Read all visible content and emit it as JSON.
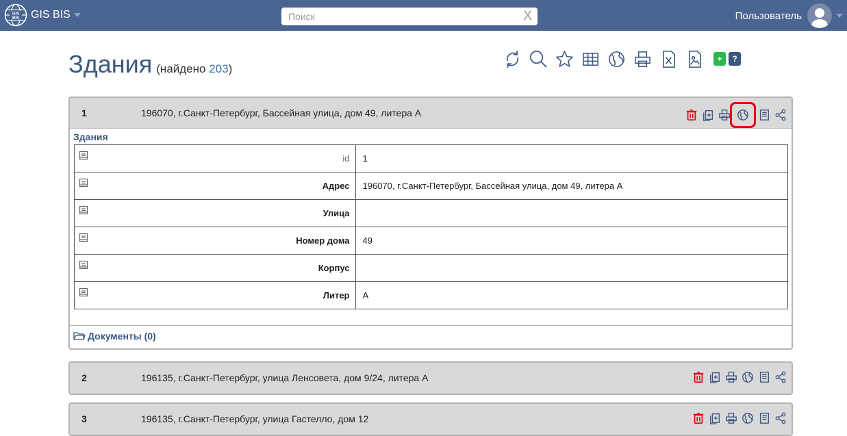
{
  "app": {
    "brand": "GIS BIS",
    "user": "Пользователь"
  },
  "search": {
    "placeholder": "Поиск",
    "clear": "X"
  },
  "header": {
    "title": "Здания",
    "found_prefix": "(найдено ",
    "found_count": "203",
    "found_suffix": ")"
  },
  "toolbar": {
    "add": "+",
    "help": "?"
  },
  "records": [
    {
      "num": "1",
      "address": "196070, г.Санкт-Петербург, Бассейная улица, дом 49, литера А",
      "section": "Здания",
      "fields": [
        {
          "label": "id",
          "value": "1"
        },
        {
          "label": "Адрес",
          "value": "196070, г.Санкт-Петербург, Бассейная улица, дом 49, литера А"
        },
        {
          "label": "Улица",
          "value": ""
        },
        {
          "label": "Номер дома",
          "value": "49"
        },
        {
          "label": "Корпус",
          "value": ""
        },
        {
          "label": "Литер",
          "value": "А"
        }
      ],
      "documents": "Документы (0)"
    },
    {
      "num": "2",
      "address": "196135, г.Санкт-Петербург, улица Ленсовета, дом 9/24, литера А"
    },
    {
      "num": "3",
      "address": "196135, г.Санкт-Петербург, улица Гастелло, дом 12"
    }
  ],
  "colors": {
    "navbar": "#4a6591",
    "title": "#3a5781",
    "delete": "#e0000f",
    "add": "#2db84d",
    "highlight": "#e0000f"
  },
  "icons": [
    "globe-logo-icon",
    "refresh-icon",
    "search-icon",
    "star-icon",
    "table-icon",
    "globe-icon",
    "print-icon",
    "excel-icon",
    "image-file-icon",
    "trash-icon",
    "copy-icon",
    "note-icon",
    "share-icon",
    "folder-icon"
  ]
}
